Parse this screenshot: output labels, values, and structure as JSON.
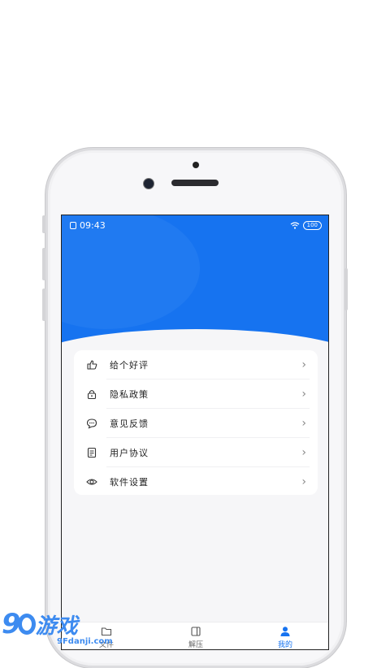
{
  "status_bar": {
    "time": "09:43",
    "battery": "100"
  },
  "menu": [
    {
      "label": "给个好评",
      "icon": "thumbs-up-icon"
    },
    {
      "label": "隐私政策",
      "icon": "lock-icon"
    },
    {
      "label": "意见反馈",
      "icon": "chat-bubble-icon"
    },
    {
      "label": "用户协议",
      "icon": "document-icon"
    },
    {
      "label": "软件设置",
      "icon": "eye-icon"
    }
  ],
  "tabs": [
    {
      "label": "文件",
      "icon": "folder-icon"
    },
    {
      "label": "解压",
      "icon": "archive-icon"
    },
    {
      "label": "我的",
      "icon": "user-icon"
    }
  ],
  "watermark": {
    "brand": "9",
    "suffix": "游戏",
    "domain": "9Fdanji.com"
  },
  "colors": {
    "accent": "#1673f0"
  }
}
